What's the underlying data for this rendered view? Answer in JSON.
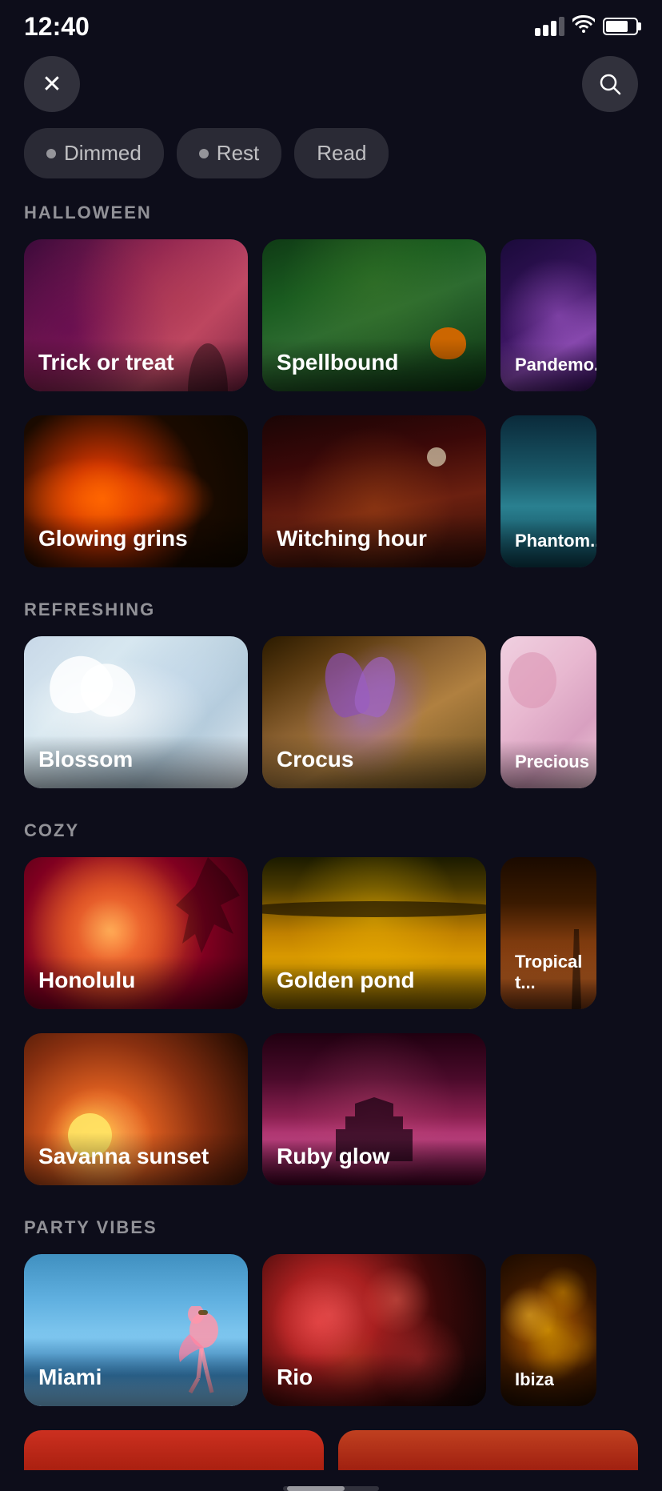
{
  "status": {
    "time": "12:40"
  },
  "header": {
    "close_label": "×",
    "search_label": "🔍"
  },
  "filters": [
    {
      "label": "Dimmed",
      "id": "dimmed"
    },
    {
      "label": "Rest",
      "id": "rest"
    },
    {
      "label": "Read",
      "id": "read"
    }
  ],
  "sections": [
    {
      "id": "halloween",
      "label": "HALLOWEEN",
      "cards": [
        {
          "id": "trick-or-treat",
          "label": "Trick or treat"
        },
        {
          "id": "spellbound",
          "label": "Spellbound"
        },
        {
          "id": "pandemonium",
          "label": "Pandemo..."
        }
      ],
      "cards2": [
        {
          "id": "glowing-grins",
          "label": "Glowing grins"
        },
        {
          "id": "witching-hour",
          "label": "Witching hour"
        },
        {
          "id": "phantom",
          "label": "Phantom..."
        }
      ]
    },
    {
      "id": "refreshing",
      "label": "REFRESHING",
      "cards": [
        {
          "id": "blossom",
          "label": "Blossom"
        },
        {
          "id": "crocus",
          "label": "Crocus"
        },
        {
          "id": "precious",
          "label": "Precious"
        }
      ]
    },
    {
      "id": "cozy",
      "label": "COZY",
      "cards": [
        {
          "id": "honolulu",
          "label": "Honolulu"
        },
        {
          "id": "golden-pond",
          "label": "Golden pond"
        },
        {
          "id": "tropical",
          "label": "Tropical t..."
        }
      ],
      "cards2": [
        {
          "id": "savanna-sunset",
          "label": "Savanna sunset"
        },
        {
          "id": "ruby-glow",
          "label": "Ruby glow"
        }
      ]
    },
    {
      "id": "party-vibes",
      "label": "PARTY VIBES",
      "cards": [
        {
          "id": "miami",
          "label": "Miami"
        },
        {
          "id": "rio",
          "label": "Rio"
        },
        {
          "id": "ibiza",
          "label": "Ibiza"
        }
      ]
    }
  ]
}
